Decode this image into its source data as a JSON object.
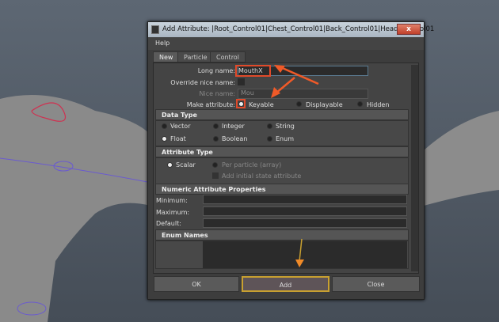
{
  "window": {
    "title": "Add Attribute: |Root_Control01|Chest_Control01|Back_Control01|Head_Control01",
    "close": "x"
  },
  "menu": [
    "Help"
  ],
  "tabs": [
    {
      "label": "New",
      "active": true
    },
    {
      "label": "Particle"
    },
    {
      "label": "Control"
    }
  ],
  "form": {
    "long_name_label": "Long name:",
    "long_name_value": "MouthX",
    "override_label": "Override nice name:",
    "nice_name_label": "Nice name:",
    "nice_name_value": "Mou",
    "make_attr_label": "Make attribute:",
    "make_attr_options": [
      "Keyable",
      "Displayable",
      "Hidden"
    ],
    "make_attr_selected": "Keyable"
  },
  "data_type": {
    "title": "Data Type",
    "options": [
      "Vector",
      "Integer",
      "String",
      "Float",
      "Boolean",
      "Enum"
    ],
    "selected": "Float"
  },
  "attribute_type": {
    "title": "Attribute Type",
    "scalar": "Scalar",
    "per_particle": "Per particle (array)",
    "add_initial": "Add initial state attribute",
    "selected": "Scalar"
  },
  "numeric": {
    "title": "Numeric Attribute Properties",
    "minimum": "Minimum:",
    "maximum": "Maximum:",
    "default": "Default:"
  },
  "enum": {
    "title": "Enum Names"
  },
  "buttons": {
    "ok": "OK",
    "add": "Add",
    "close": "Close"
  },
  "colors": {
    "annotation_arrow": "#f05a28",
    "highlight": "#e04a2a",
    "add_highlight": "#c8a030"
  }
}
